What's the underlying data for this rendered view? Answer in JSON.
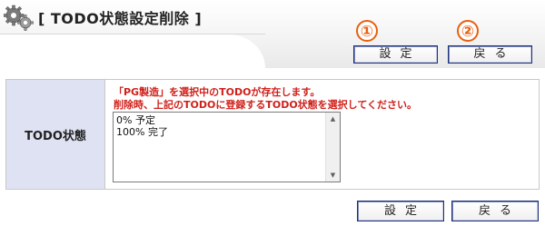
{
  "header": {
    "title": "[ TODO状態設定削除 ]"
  },
  "markers": [
    "①",
    "②"
  ],
  "buttons": {
    "set_label": "設定",
    "back_label": "戻る"
  },
  "form": {
    "field_label": "TODO状態",
    "message_line1": "「PG製造」を選択中のTODOが存在します。",
    "message_line2": "削除時、上記のTODOに登録するTODO状態を選択してください。",
    "options": [
      "0% 予定",
      "100% 完了"
    ]
  },
  "colors": {
    "label_bg": "#dfe2f2",
    "message": "#d0201a",
    "marker": "#e86010",
    "button_border": "#1d2f7a"
  }
}
